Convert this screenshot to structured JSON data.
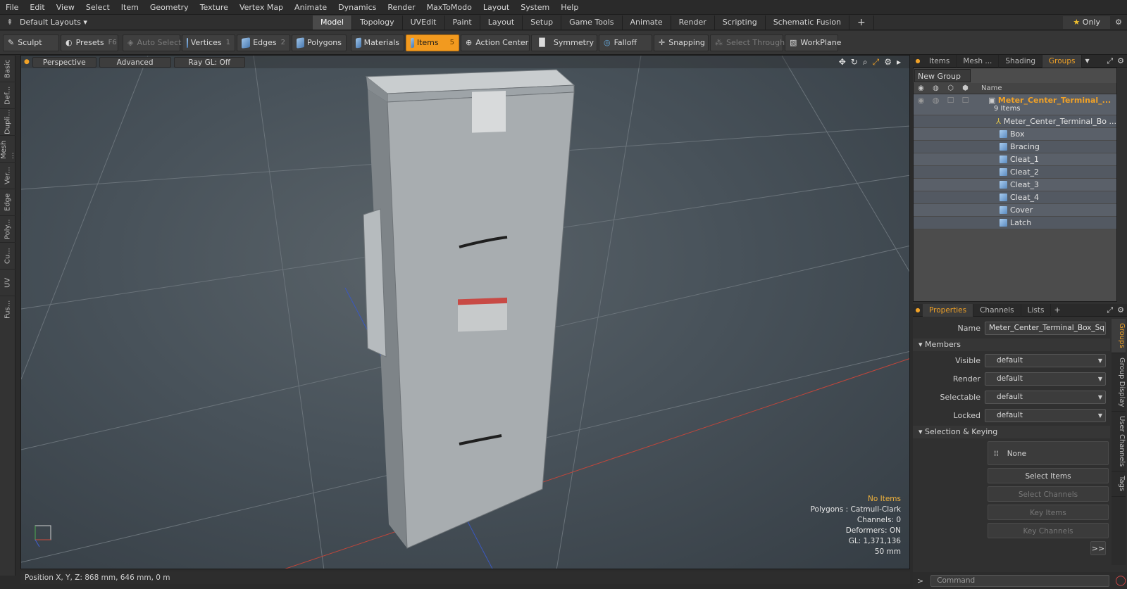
{
  "menu": [
    "File",
    "Edit",
    "View",
    "Select",
    "Item",
    "Geometry",
    "Texture",
    "Vertex Map",
    "Animate",
    "Dynamics",
    "Render",
    "MaxToModo",
    "Layout",
    "System",
    "Help"
  ],
  "layout_selector": "Default Layouts",
  "layout_tabs": [
    {
      "label": "Model",
      "active": true
    },
    {
      "label": "Topology"
    },
    {
      "label": "UVEdit"
    },
    {
      "label": "Paint"
    },
    {
      "label": "Layout"
    },
    {
      "label": "Setup"
    },
    {
      "label": "Game Tools"
    },
    {
      "label": "Animate"
    },
    {
      "label": "Render"
    },
    {
      "label": "Scripting"
    },
    {
      "label": "Schematic Fusion"
    }
  ],
  "only_label": "Only",
  "toolbar": {
    "sculpt": "Sculpt",
    "presets": "Presets",
    "presets_key": "F6",
    "auto_select": "Auto Select",
    "vertices": "Vertices",
    "vertices_key": "1",
    "edges": "Edges",
    "edges_key": "2",
    "polygons": "Polygons",
    "materials": "Materials",
    "items": "Items",
    "items_key": "5",
    "action_center": "Action Center",
    "symmetry": "Symmetry",
    "falloff": "Falloff",
    "snapping": "Snapping",
    "select_through": "Select Through",
    "workplane": "WorkPlane"
  },
  "left_tabs": [
    "Basic",
    "Def...",
    "Dupli...",
    "Mesh ...",
    "Ver...",
    "Edge",
    "Poly...",
    "Cu...",
    "UV",
    "Fus..."
  ],
  "viewport": {
    "perspective": "Perspective",
    "advanced": "Advanced",
    "raygl": "Ray GL: Off",
    "overlay": {
      "no_items": "No Items",
      "polygons": "Polygons : Catmull-Clark",
      "channels": "Channels: 0",
      "deformers": "Deformers: ON",
      "gl": "GL: 1,371,136",
      "scale": "50 mm"
    }
  },
  "status": "Position X, Y, Z:  868 mm, 646 mm, 0 m",
  "right_tabs": [
    {
      "label": "Items"
    },
    {
      "label": "Mesh ..."
    },
    {
      "label": "Shading"
    },
    {
      "label": "Groups",
      "active": true
    }
  ],
  "tree": {
    "new_group": "New Group",
    "name_header": "Name",
    "group_name": "Meter_Center_Terminal_...",
    "group_count": "9 Items",
    "children": [
      "Meter_Center_Terminal_Bo ...",
      "Box",
      "Bracing",
      "Cleat_1",
      "Cleat_2",
      "Cleat_3",
      "Cleat_4",
      "Cover",
      "Latch"
    ]
  },
  "props_tabs": [
    {
      "label": "Properties",
      "active": true
    },
    {
      "label": "Channels"
    },
    {
      "label": "Lists"
    }
  ],
  "properties": {
    "name_label": "Name",
    "name_value": "Meter_Center_Terminal_Box_Squ",
    "members_section": "Members",
    "visible_label": "Visible",
    "visible_value": "default",
    "render_label": "Render",
    "render_value": "default",
    "selectable_label": "Selectable",
    "selectable_value": "default",
    "locked_label": "Locked",
    "locked_value": "default",
    "keying_section": "Selection & Keying",
    "none_label": "None",
    "select_items": "Select Items",
    "select_channels": "Select Channels",
    "key_items": "Key Items",
    "key_channels": "Key Channels",
    "more": ">>"
  },
  "side_tabs": [
    {
      "label": "Groups",
      "active": true
    },
    {
      "label": "Group Display"
    },
    {
      "label": "User Channels"
    },
    {
      "label": "Tags"
    }
  ],
  "command": {
    "placeholder": "Command"
  }
}
